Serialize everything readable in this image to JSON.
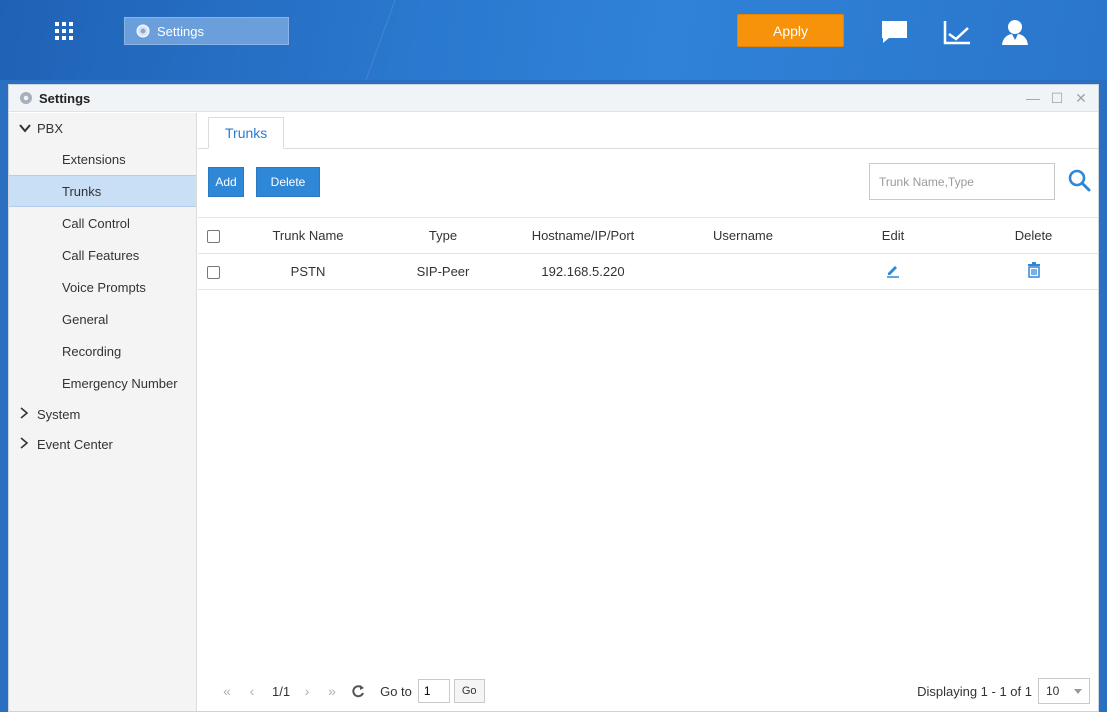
{
  "topbar": {
    "taskbar_item": "Settings",
    "apply_label": "Apply"
  },
  "window": {
    "title": "Settings",
    "controls": {
      "minimize": "—",
      "maximize": "☐",
      "close": "✕"
    }
  },
  "sidebar": {
    "pbx": {
      "label": "PBX",
      "items": [
        "Extensions",
        "Trunks",
        "Call Control",
        "Call Features",
        "Voice Prompts",
        "General",
        "Recording",
        "Emergency Number"
      ],
      "active": "Trunks"
    },
    "system": {
      "label": "System"
    },
    "event_center": {
      "label": "Event Center"
    }
  },
  "main": {
    "tab": "Trunks",
    "toolbar": {
      "add_label": "Add",
      "delete_label": "Delete",
      "search_placeholder": "Trunk Name,Type"
    },
    "table": {
      "columns": [
        "Trunk Name",
        "Type",
        "Hostname/IP/Port",
        "Username",
        "Edit",
        "Delete"
      ],
      "rows": [
        {
          "name": "PSTN",
          "type": "SIP-Peer",
          "host": "192.168.5.220",
          "username": ""
        }
      ]
    },
    "pager": {
      "page": "1/1",
      "goto_label": "Go to",
      "goto_value": "1",
      "go_label": "Go",
      "displaying": "Displaying 1 - 1 of 1",
      "page_size": "10"
    }
  },
  "colors": {
    "accent": "#2f87d8",
    "apply": "#f7930a",
    "active_nav": "#c9dff6"
  }
}
